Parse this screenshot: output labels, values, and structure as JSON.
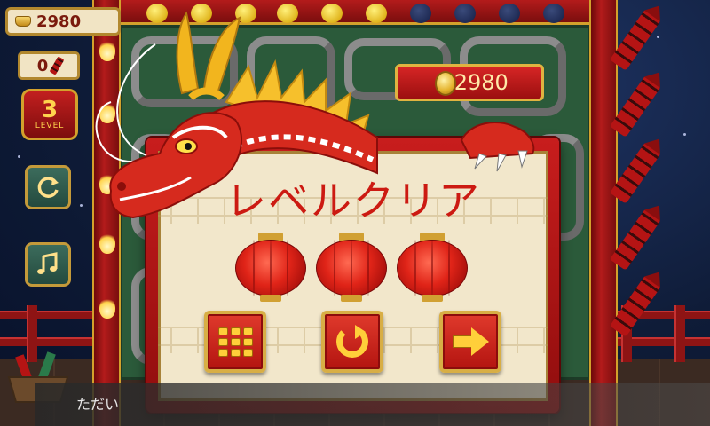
{
  "hud": {
    "gold_amount": "2980",
    "rocket_count": "0",
    "level_number": "3",
    "level_label": "LEVEL"
  },
  "score": {
    "value": ": 2980"
  },
  "popup": {
    "title": "レベルクリア",
    "lanterns_earned": 3,
    "lanterns_total": 3
  },
  "bottom_text": "ただい",
  "icons": {
    "restart_side": "refresh-icon",
    "music_side": "music-note-icon",
    "menu_button": "level-grid-icon",
    "retry_button": "retry-icon",
    "next_button": "next-arrow-icon"
  },
  "colors": {
    "accent_red": "#c81d1d",
    "gold": "#ffcf3a",
    "panel_cream": "#f2e7cb"
  }
}
